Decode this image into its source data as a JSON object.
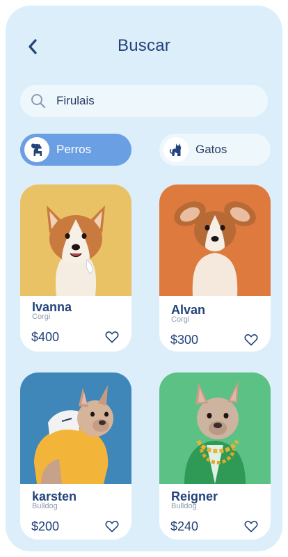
{
  "header": {
    "title": "Buscar"
  },
  "search": {
    "value": "Firulais",
    "placeholder": "Buscar"
  },
  "categories": [
    {
      "label": "Perros",
      "icon": "dog-icon",
      "active": true
    },
    {
      "label": "Gatos",
      "icon": "cat-icon",
      "active": false
    }
  ],
  "pets": [
    {
      "name": "Ivanna",
      "breed": "Corgi",
      "price": "$400",
      "bg": "#e9c265"
    },
    {
      "name": "Alvan",
      "breed": "Corgi",
      "price": "$300",
      "bg": "#de7a3d"
    },
    {
      "name": "karsten",
      "breed": "Bulldog",
      "price": "$200",
      "bg": "#3e87b8"
    },
    {
      "name": "Reigner",
      "breed": "Bulldog",
      "price": "$240",
      "bg": "#5cc184"
    }
  ],
  "colors": {
    "background": "#dbeef9",
    "accent": "#6b9fe3",
    "text_primary": "#23437a"
  }
}
